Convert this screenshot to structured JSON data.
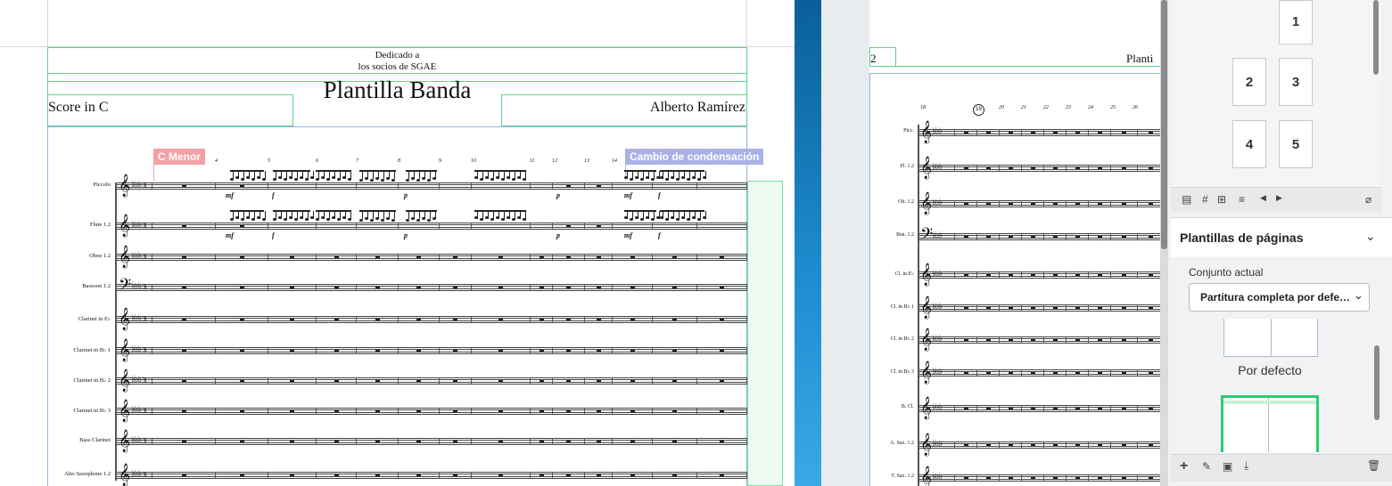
{
  "page1": {
    "dedication_line1": "Dedicado a",
    "dedication_line2": "los socios de SGAE",
    "title": "Plantilla Banda",
    "subtitle_left": "Score in C",
    "composer": "Alberto Ramírez",
    "tags": {
      "key_change": "C Menor",
      "condensation_change": "Cambio de condensación"
    },
    "measure_numbers": [
      "4",
      "5",
      "6",
      "7",
      "8",
      "9",
      "10",
      "11",
      "12",
      "13",
      "14"
    ],
    "instruments": [
      "Piccolo",
      "Flute 1.2",
      "Oboe 1.2",
      "Bassoon 1.2",
      "Clarinet in E♭",
      "Clarinet in B♭ 1",
      "Clarinet in B♭ 2",
      "Clarinet in B♭ 3",
      "Bass Clarinet",
      "Alto Saxophone 1.2"
    ],
    "dynamics": {
      "mf": "mf",
      "f": "f",
      "p": "p",
      "tuplet": "3"
    },
    "time_signature": {
      "top": "3",
      "bottom": "4"
    }
  },
  "page2": {
    "page_number": "2",
    "title_partial": "Planti",
    "measure_numbers": [
      "18",
      "19",
      "20",
      "21",
      "22",
      "23",
      "24",
      "25",
      "26"
    ],
    "rehearsal_mark": "19",
    "instruments": [
      "Picc.",
      "Fl. 1.2",
      "Ob. 1.2",
      "Bsn. 1.2",
      "Cl. in E♭",
      "Cl. in B♭ 1",
      "Cl. in B♭ 2",
      "Cl. in B♭ 3",
      "B. Cl.",
      "A. Sax. 1.2",
      "T. Sax. 1.2"
    ]
  },
  "panel": {
    "page_thumbnails": [
      "1",
      "2",
      "3",
      "4",
      "5"
    ],
    "section_title": "Plantillas de páginas",
    "current_set_label": "Conjunto actual",
    "current_set_value": "Partitura completa por defe…",
    "template_default_label": "Por defecto",
    "toolbar_icons": [
      "page-icon",
      "hash-icon",
      "frame-icon",
      "align-icon",
      "prev-icon",
      "next-icon",
      "clear-icon"
    ],
    "bottom_icons": [
      "add-icon",
      "edit-icon",
      "frame-tool-icon",
      "import-icon",
      "delete-icon"
    ],
    "accent_color": "#2ecc71"
  }
}
